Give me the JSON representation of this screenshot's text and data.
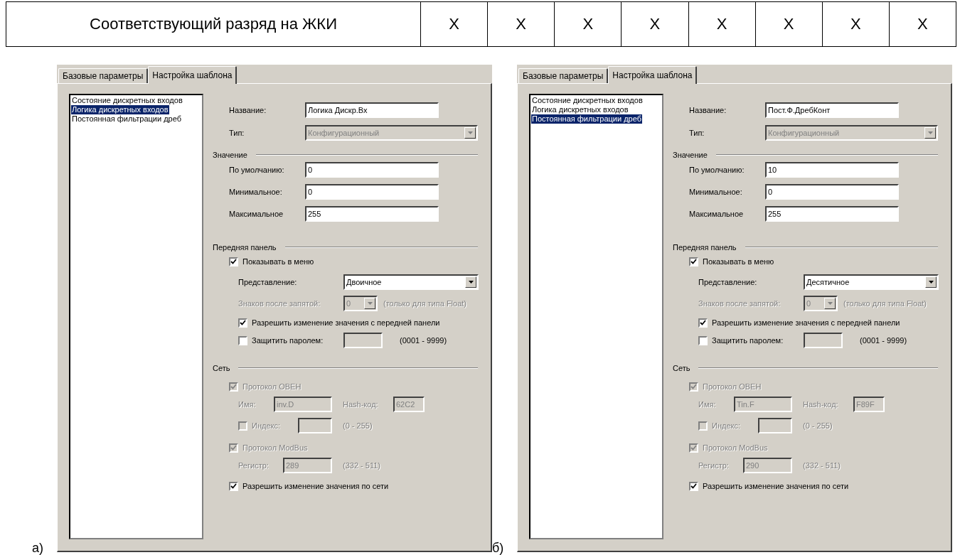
{
  "table_row": {
    "title": "Соответствующий разряд на ЖКИ",
    "cells": [
      "X",
      "X",
      "X",
      "X",
      "X",
      "X",
      "X",
      "X"
    ]
  },
  "dialogs": [
    {
      "caption": "а)",
      "tabs": [
        {
          "label": "Базовые параметры",
          "selected": false
        },
        {
          "label": "Настройка шаблона",
          "selected": true
        }
      ],
      "list": [
        {
          "label": "Состояние дискретных входов",
          "selected": false
        },
        {
          "label": "Логика дискретных входов",
          "selected": true
        },
        {
          "label": "Постоянная фильтрации дреб",
          "selected": false
        }
      ],
      "name": {
        "label": "Название:",
        "value": "Логика Дискр.Вх"
      },
      "type": {
        "label": "Тип:",
        "value": "Конфигурационный",
        "disabled": true
      },
      "value_section": {
        "title": "Значение",
        "fields": [
          {
            "label": "По умолчанию:",
            "value": "0"
          },
          {
            "label": "Минимальное:",
            "value": "0"
          },
          {
            "label": "Максимальное",
            "value": "255"
          }
        ]
      },
      "front_panel": {
        "title": "Передняя панель",
        "show_in_menu": {
          "label": "Показывать в меню",
          "checked": true
        },
        "representation": {
          "label": "Представление:",
          "value": "Двоичное",
          "disabled": false
        },
        "decimals": {
          "label": "Знаков после запятой:",
          "value": "0",
          "disabled": true
        },
        "decimals_note": "(только для типа Float)",
        "allow_edit": {
          "label": "Разрешить изменение значения с передней панели",
          "checked": true
        },
        "password": {
          "label": "Защитить паролем:",
          "checked": false
        },
        "password_range": "(0001 - 9999)"
      },
      "network": {
        "title": "Сеть",
        "oven": {
          "label": "Протокол ОВЕН",
          "checked": true,
          "disabled": true
        },
        "name": {
          "label": "Имя:",
          "value": "inv.D"
        },
        "hash": {
          "label": "Hash-код:",
          "value": "62C2"
        },
        "index": {
          "label": "Индекс:",
          "checked": false
        },
        "index_range": "(0 - 255)",
        "modbus": {
          "label": "Протокол ModBus",
          "checked": true,
          "disabled": true
        },
        "register": {
          "label": "Регистр:",
          "value": "289"
        },
        "register_range": "(332 - 511)",
        "allow_network": {
          "label": "Разрешить изменение значения по сети",
          "checked": true
        }
      }
    },
    {
      "caption": "б)",
      "tabs": [
        {
          "label": "Базовые параметры",
          "selected": false
        },
        {
          "label": "Настройка шаблона",
          "selected": true
        }
      ],
      "list": [
        {
          "label": "Состояние дискретных входов",
          "selected": false
        },
        {
          "label": "Логика дискретных входов",
          "selected": false
        },
        {
          "label": "Постоянная фильтрации дреб",
          "selected": true
        }
      ],
      "name": {
        "label": "Название:",
        "value": "Пост.Ф.ДребКонт"
      },
      "type": {
        "label": "Тип:",
        "value": "Конфигурационный",
        "disabled": true
      },
      "value_section": {
        "title": "Значение",
        "fields": [
          {
            "label": "По умолчанию:",
            "value": "10"
          },
          {
            "label": "Минимальное:",
            "value": "0"
          },
          {
            "label": "Максимальное",
            "value": "255"
          }
        ]
      },
      "front_panel": {
        "title": "Передняя панель",
        "show_in_menu": {
          "label": "Показывать в меню",
          "checked": true
        },
        "representation": {
          "label": "Представление:",
          "value": "Десятичное",
          "disabled": false
        },
        "decimals": {
          "label": "Знаков после запятой:",
          "value": "0",
          "disabled": true
        },
        "decimals_note": "(только для типа Float)",
        "allow_edit": {
          "label": "Разрешить изменение значения с передней панели",
          "checked": true
        },
        "password": {
          "label": "Защитить паролем:",
          "checked": false
        },
        "password_range": "(0001 - 9999)"
      },
      "network": {
        "title": "Сеть",
        "oven": {
          "label": "Протокол ОВЕН",
          "checked": true,
          "disabled": true
        },
        "name": {
          "label": "Имя:",
          "value": "Tin.F"
        },
        "hash": {
          "label": "Hash-код:",
          "value": "F89F"
        },
        "index": {
          "label": "Индекс:",
          "checked": false
        },
        "index_range": "(0 - 255)",
        "modbus": {
          "label": "Протокол ModBus",
          "checked": true,
          "disabled": true
        },
        "register": {
          "label": "Регистр:",
          "value": "290"
        },
        "register_range": "(332 - 511)",
        "allow_network": {
          "label": "Разрешить изменение значения по сети",
          "checked": true
        }
      }
    }
  ]
}
